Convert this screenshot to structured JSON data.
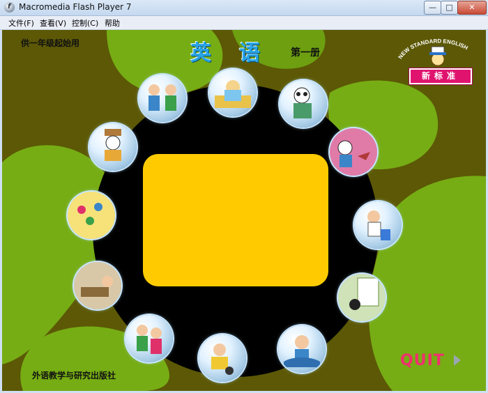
{
  "window": {
    "title": "Macromedia Flash Player 7",
    "controls": {
      "minimize": "—",
      "maximize": "□",
      "close": "✕"
    }
  },
  "menu": {
    "items": [
      "文件(F)",
      "查看(V)",
      "控制(C)",
      "帮助"
    ]
  },
  "content": {
    "supply_label": "供一年级起始用",
    "title": "英语",
    "volume": "第一册",
    "publisher": "外语教学与研究出版社",
    "logo": {
      "arc_text": "NEW STANDARD ENGLISH",
      "box_text": "新标准"
    },
    "quit": "QUIT",
    "lessons": [
      {
        "name": "lesson-module-1",
        "scene": "two kids greeting"
      },
      {
        "name": "lesson-module-2",
        "scene": "girl with book"
      },
      {
        "name": "lesson-module-3",
        "scene": "panda with bag"
      },
      {
        "name": "lesson-module-4",
        "scene": "panda and bird"
      },
      {
        "name": "lesson-module-5",
        "scene": "girl on chair"
      },
      {
        "name": "lesson-module-6",
        "scene": "cat at window"
      },
      {
        "name": "lesson-module-7",
        "scene": "boy waving"
      },
      {
        "name": "lesson-module-8",
        "scene": "child with dog"
      },
      {
        "name": "lesson-module-9",
        "scene": "girl and boy"
      },
      {
        "name": "lesson-module-10",
        "scene": "classroom"
      },
      {
        "name": "lesson-module-11",
        "scene": "colorful animals"
      },
      {
        "name": "lesson-module-12",
        "scene": "panda with hat"
      }
    ],
    "colors": {
      "background": "#5c5806",
      "green_blob": "#76ad14",
      "disc": "#000000",
      "panel": "#ffcb00",
      "title": "#2aa6e8",
      "quit": "#f0306f"
    }
  }
}
